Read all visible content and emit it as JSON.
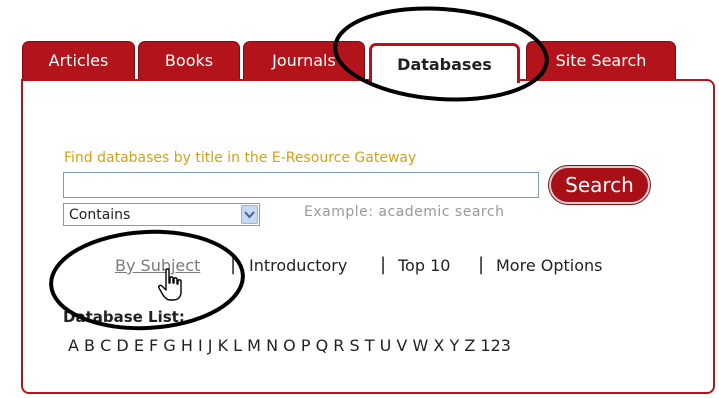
{
  "tabs": [
    {
      "label": "Articles"
    },
    {
      "label": "Books"
    },
    {
      "label": "Journals"
    },
    {
      "label": "Databases",
      "active": true
    },
    {
      "label": "Site Search"
    }
  ],
  "search": {
    "label": "Find databases by title in the E-Resource Gateway",
    "value": "",
    "button": "Search",
    "match_select": "Contains",
    "example": "Example: academic search"
  },
  "browse_links": {
    "by_subject": "By Subject",
    "introductory": "Introductory",
    "top10": "Top 10",
    "more_options": "More Options"
  },
  "database_list": {
    "label": "Database List:",
    "letters": [
      "A",
      "B",
      "C",
      "D",
      "E",
      "F",
      "G",
      "H",
      "I",
      "J",
      "K",
      "L",
      "M",
      "N",
      "O",
      "P",
      "Q",
      "R",
      "S",
      "T",
      "U",
      "V",
      "W",
      "X",
      "Y",
      "Z",
      "123"
    ]
  },
  "colors": {
    "brand_red": "#b3141b",
    "label_gold": "#d4a017",
    "annotation": "#000000"
  }
}
